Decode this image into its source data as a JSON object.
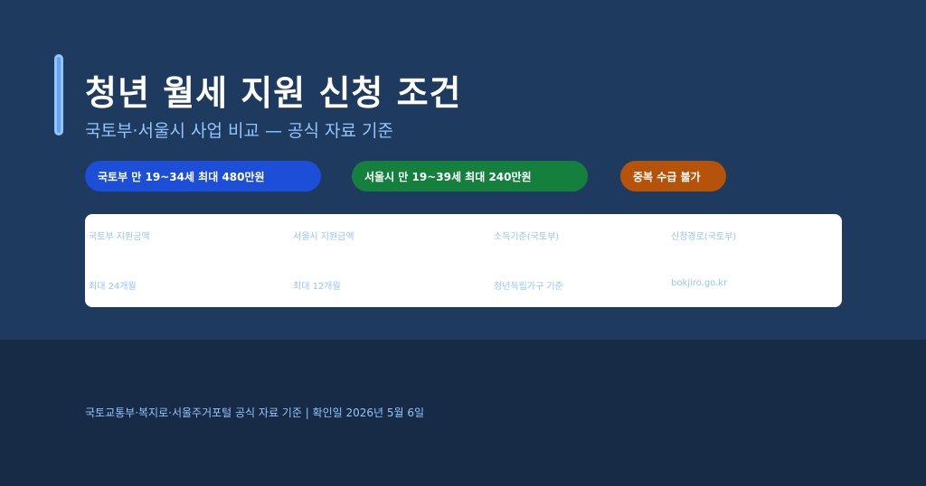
{
  "header": {
    "title": "청년 월세 지원 신청 조건",
    "subtitle": "국토부·서울시 사업 비교 — 공식 자료 기준"
  },
  "pills": {
    "national": "국토부 만 19~34세 최대 480만원",
    "seoul": "서울시 만 19~39세 최대 240만원",
    "duplicate": "중복 수급 불가"
  },
  "table": {
    "headers": [
      "국토부 지원금액",
      "서울시 지원금액",
      "소득기준(국토부)",
      "신청경로(국토부)"
    ],
    "values": [
      "최대 24개월",
      "최대 12개월",
      "청년독립가구 기준",
      "bokjiro.go.kr"
    ]
  },
  "footer": {
    "text": "국토교통부·복지로·서울주거포털 공식 자료 기준 | 확인일 2026년 5월 6일"
  },
  "colors": {
    "background": "#1e3a5f",
    "footer_background": "#172a46",
    "accent": "#93c5fd",
    "pill_blue": "#1d4ed8",
    "pill_green": "#15803d",
    "pill_orange": "#b45309"
  }
}
